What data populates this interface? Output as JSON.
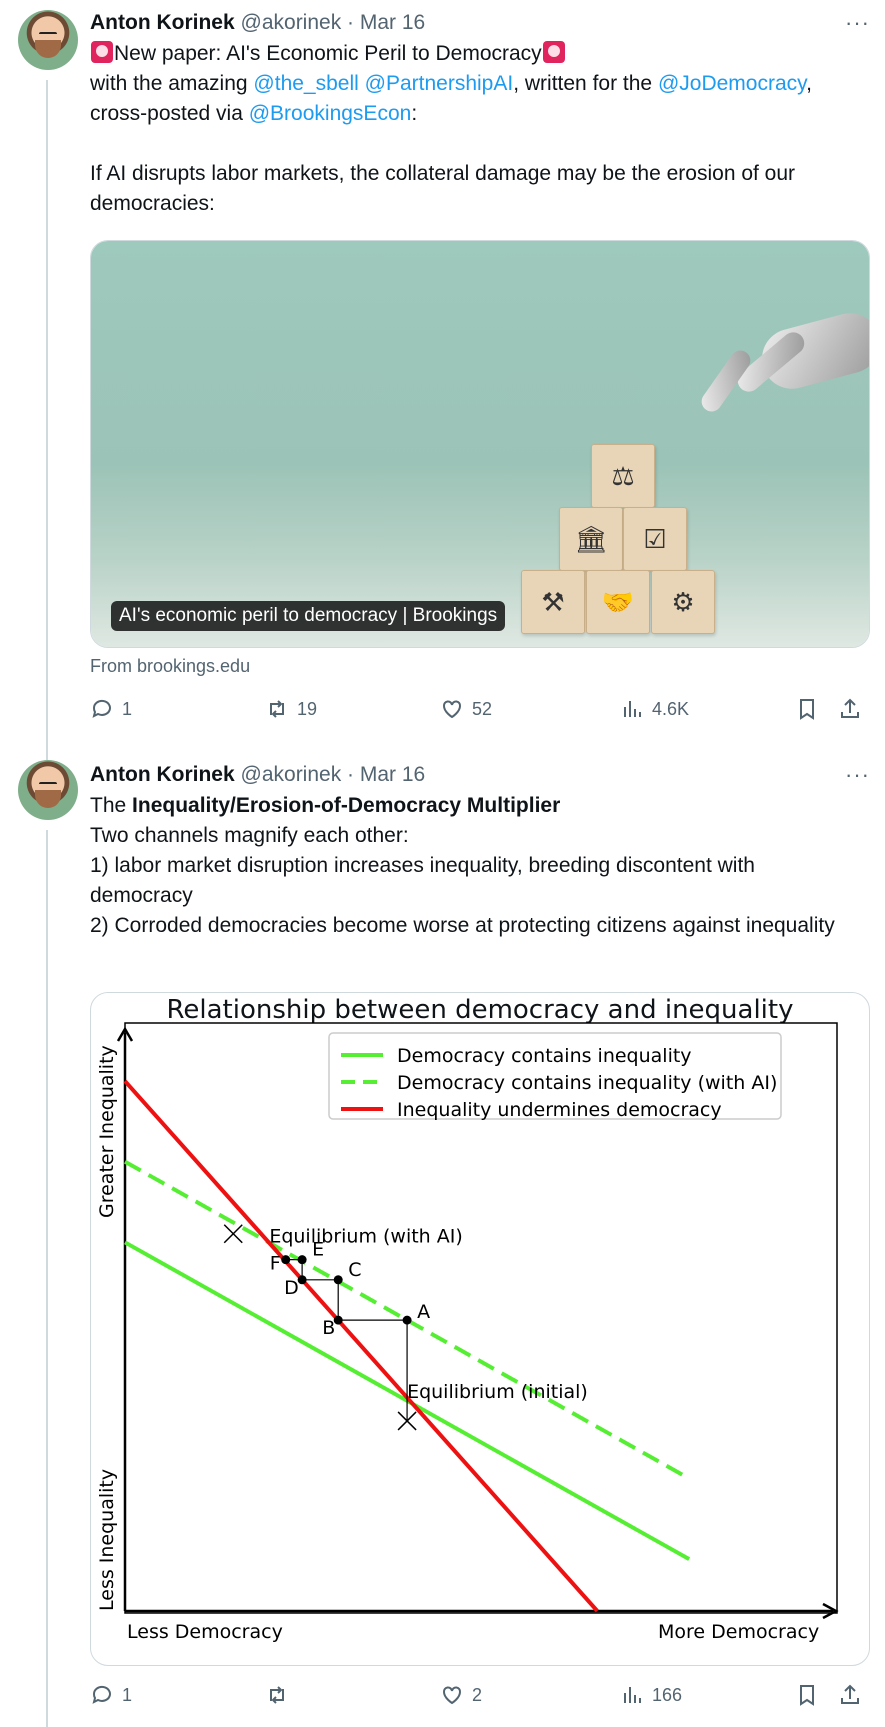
{
  "tweet1": {
    "name": "Anton Korinek",
    "meta": "@akorinek · Mar 16",
    "more": "···",
    "line1": "New paper: AI's Economic Peril to Democracy",
    "line2_pre": "with the amazing ",
    "mention1": "@the_sbell",
    "mention2": "@PartnershipAI",
    "line2_mid": ", written for the ",
    "mention3": "@JoDemocracy",
    "line2_end": ",",
    "line3_pre": "cross-posted via ",
    "mention4": "@BrookingsEcon",
    "line3_end": ":",
    "para2": "If AI disrupts labor markets, the collateral damage may be the erosion of our democracies:",
    "card_caption": "AI's economic peril to democracy | Brookings",
    "source": "From brookings.edu",
    "replies": "1",
    "reposts": "19",
    "likes": "52",
    "views": "4.6K"
  },
  "tweet2": {
    "name": "Anton Korinek",
    "meta": "@akorinek · Mar 16",
    "more": "···",
    "intro_pre": "The ",
    "intro_bold": "Inequality/Erosion-of-Democracy Multiplier",
    "line2": "Two channels magnify each other:",
    "line3": "1) labor market disruption increases inequality, breeding discontent with democracy",
    "line4": "2) Corroded democracies become worse at protecting citizens against inequality",
    "replies": "1",
    "reposts": "",
    "likes": "2",
    "views": "166"
  },
  "chart_data": {
    "type": "line",
    "title": "Relationship between democracy and inequality",
    "xlabel_left": "Less Democracy",
    "xlabel_right": "More Democracy",
    "ylabel_top": "Greater Inequality",
    "ylabel_bottom": "Less Inequality",
    "xlim": [
      0,
      10
    ],
    "ylim": [
      0,
      10
    ],
    "series": [
      {
        "name": "Democracy contains inequality",
        "color": "#55ee33",
        "style": "solid",
        "x": [
          0,
          8.6
        ],
        "y": [
          6.4,
          0.9
        ]
      },
      {
        "name": "Democracy contains inequality (with AI)",
        "color": "#55ee33",
        "style": "dashed",
        "x": [
          0,
          8.6
        ],
        "y": [
          7.8,
          2.3
        ]
      },
      {
        "name": "Inequality undermines democracy",
        "color": "#ee1111",
        "style": "solid",
        "x": [
          0,
          7.2
        ],
        "y": [
          9.2,
          0
        ]
      }
    ],
    "points": [
      {
        "label": "A",
        "x": 4.3,
        "y": 5.05
      },
      {
        "label": "B",
        "x": 3.25,
        "y": 5.05
      },
      {
        "label": "C",
        "x": 3.25,
        "y": 5.75
      },
      {
        "label": "D",
        "x": 2.7,
        "y": 5.75
      },
      {
        "label": "E",
        "x": 2.7,
        "y": 6.1
      },
      {
        "label": "F",
        "x": 2.45,
        "y": 6.1
      }
    ],
    "annotations": [
      {
        "text": "Equilibrium (with AI)",
        "x": 2.2,
        "y": 6.4
      },
      {
        "text": "Equilibrium (initial)",
        "x": 4.3,
        "y": 3.7
      }
    ]
  }
}
